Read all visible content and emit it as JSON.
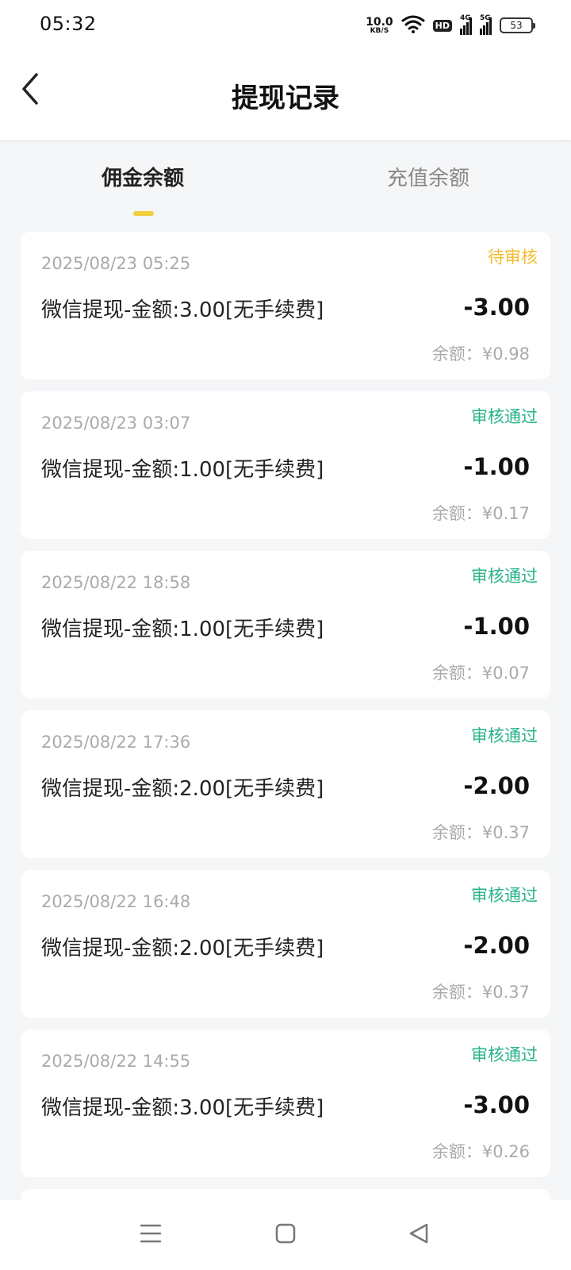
{
  "status_bar": {
    "time": "05:32",
    "net_speed_value": "10.0",
    "net_speed_unit": "KB/S",
    "hd_label": "HD",
    "signal1_label": "4G",
    "signal2_label": "5G",
    "battery": "53"
  },
  "header": {
    "title": "提现记录",
    "back_icon": "chevron-left-icon"
  },
  "tabs": [
    {
      "label": "佣金余额",
      "active": true
    },
    {
      "label": "充值余额",
      "active": false
    }
  ],
  "colors": {
    "accent": "#f0cf3a",
    "pending": "#f0bc2e",
    "approved": "#28b38a"
  },
  "records": [
    {
      "date": "2025/08/23 05:25",
      "status": "待审核",
      "desc": "微信提现-金额:3.00[无手续费]",
      "amount": "-3.00",
      "balance": "余额：¥0.98"
    },
    {
      "date": "2025/08/23 03:07",
      "status": "审核通过",
      "desc": "微信提现-金额:1.00[无手续费]",
      "amount": "-1.00",
      "balance": "余额：¥0.17"
    },
    {
      "date": "2025/08/22 18:58",
      "status": "审核通过",
      "desc": "微信提现-金额:1.00[无手续费]",
      "amount": "-1.00",
      "balance": "余额：¥0.07"
    },
    {
      "date": "2025/08/22 17:36",
      "status": "审核通过",
      "desc": "微信提现-金额:2.00[无手续费]",
      "amount": "-2.00",
      "balance": "余额：¥0.37"
    },
    {
      "date": "2025/08/22 16:48",
      "status": "审核通过",
      "desc": "微信提现-金额:2.00[无手续费]",
      "amount": "-2.00",
      "balance": "余额：¥0.37"
    },
    {
      "date": "2025/08/22 14:55",
      "status": "审核通过",
      "desc": "微信提现-金额:3.00[无手续费]",
      "amount": "-3.00",
      "balance": "余额：¥0.26"
    }
  ],
  "nav_bar": {
    "menu_icon": "menu-icon",
    "home_icon": "home-square-icon",
    "back_icon": "back-triangle-icon"
  }
}
